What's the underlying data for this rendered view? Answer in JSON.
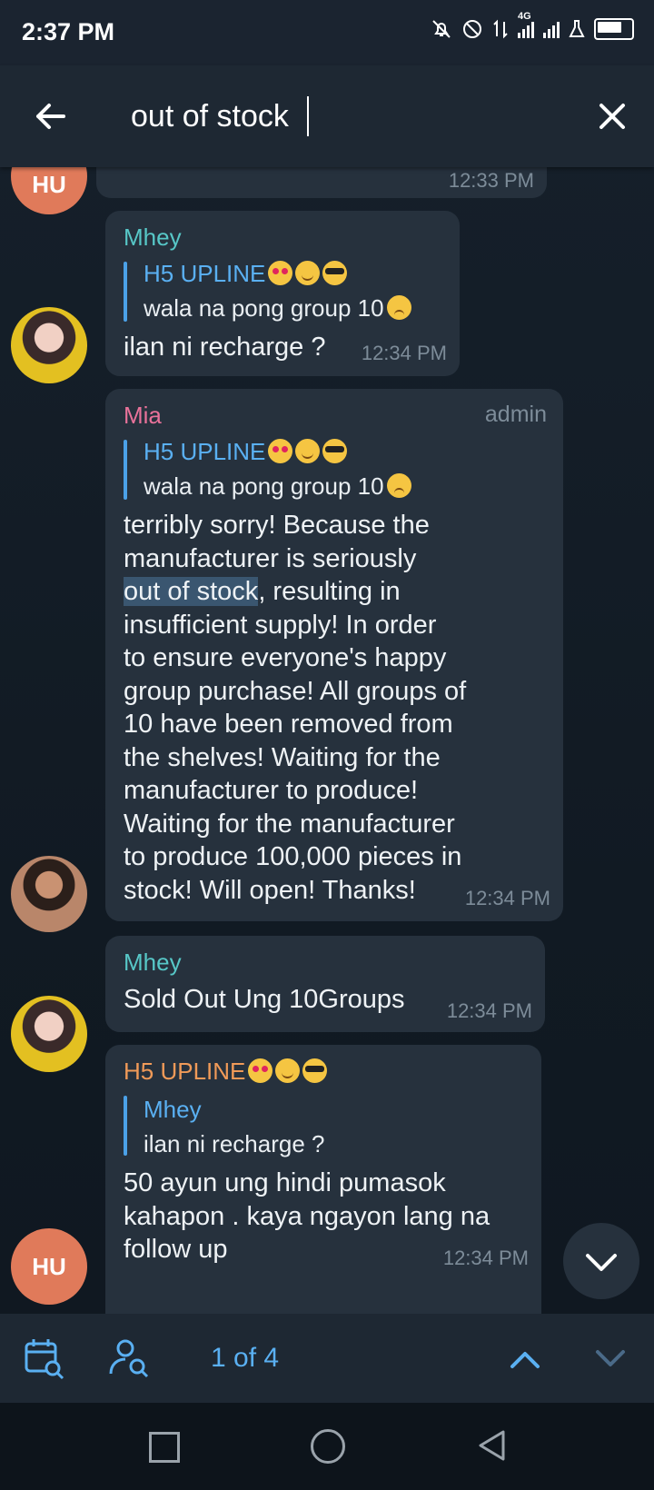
{
  "status": {
    "time": "2:37 PM",
    "network": "4G"
  },
  "search": {
    "query": "out of stock"
  },
  "messages": [
    {
      "avatar": "HU",
      "time": "12:33 PM"
    },
    {
      "sender": "Mhey",
      "reply_name": "H5 UPLINE",
      "reply_text": "wala na pong group 10",
      "text": "ilan ni recharge ?",
      "time": "12:34 PM"
    },
    {
      "sender": "Mia",
      "role": "admin",
      "reply_name": "H5 UPLINE",
      "reply_text": "wala na pong group 10",
      "text_lines": [
        "terribly sorry! Because the",
        "manufacturer is seriously",
        "out of stock",
        ", resulting in",
        "insufficient supply! In order",
        "to ensure everyone's happy",
        "group purchase! All groups of",
        "10 have been removed from",
        "the shelves! Waiting for the",
        "manufacturer to produce!",
        "Waiting for the manufacturer",
        "to produce 100,000 pieces in",
        "stock! Will open! Thanks!"
      ],
      "time": "12:34 PM"
    },
    {
      "sender": "Mhey",
      "text": "Sold Out Ung 10Groups",
      "time": "12:34 PM"
    },
    {
      "sender": "H5 UPLINE",
      "avatar": "HU",
      "reply_name": "Mhey",
      "reply_text": "ilan ni recharge ?",
      "text_lines": [
        "50 ayun ung hindi pumasok",
        "kahapon . kaya ngayon lang na",
        "follow up"
      ],
      "time": "12:34 PM"
    }
  ],
  "search_nav": {
    "result_count": "1 of 4"
  },
  "colors": {
    "accent": "#5ab0f2",
    "bubble": "#26313d",
    "highlight": "#3a5670",
    "avatar_hu": "#e07a5a"
  },
  "icons": [
    "back-arrow-icon",
    "close-icon",
    "calendar-search-icon",
    "user-search-icon",
    "chevron-up-icon",
    "chevron-down-icon",
    "scroll-down-icon"
  ]
}
